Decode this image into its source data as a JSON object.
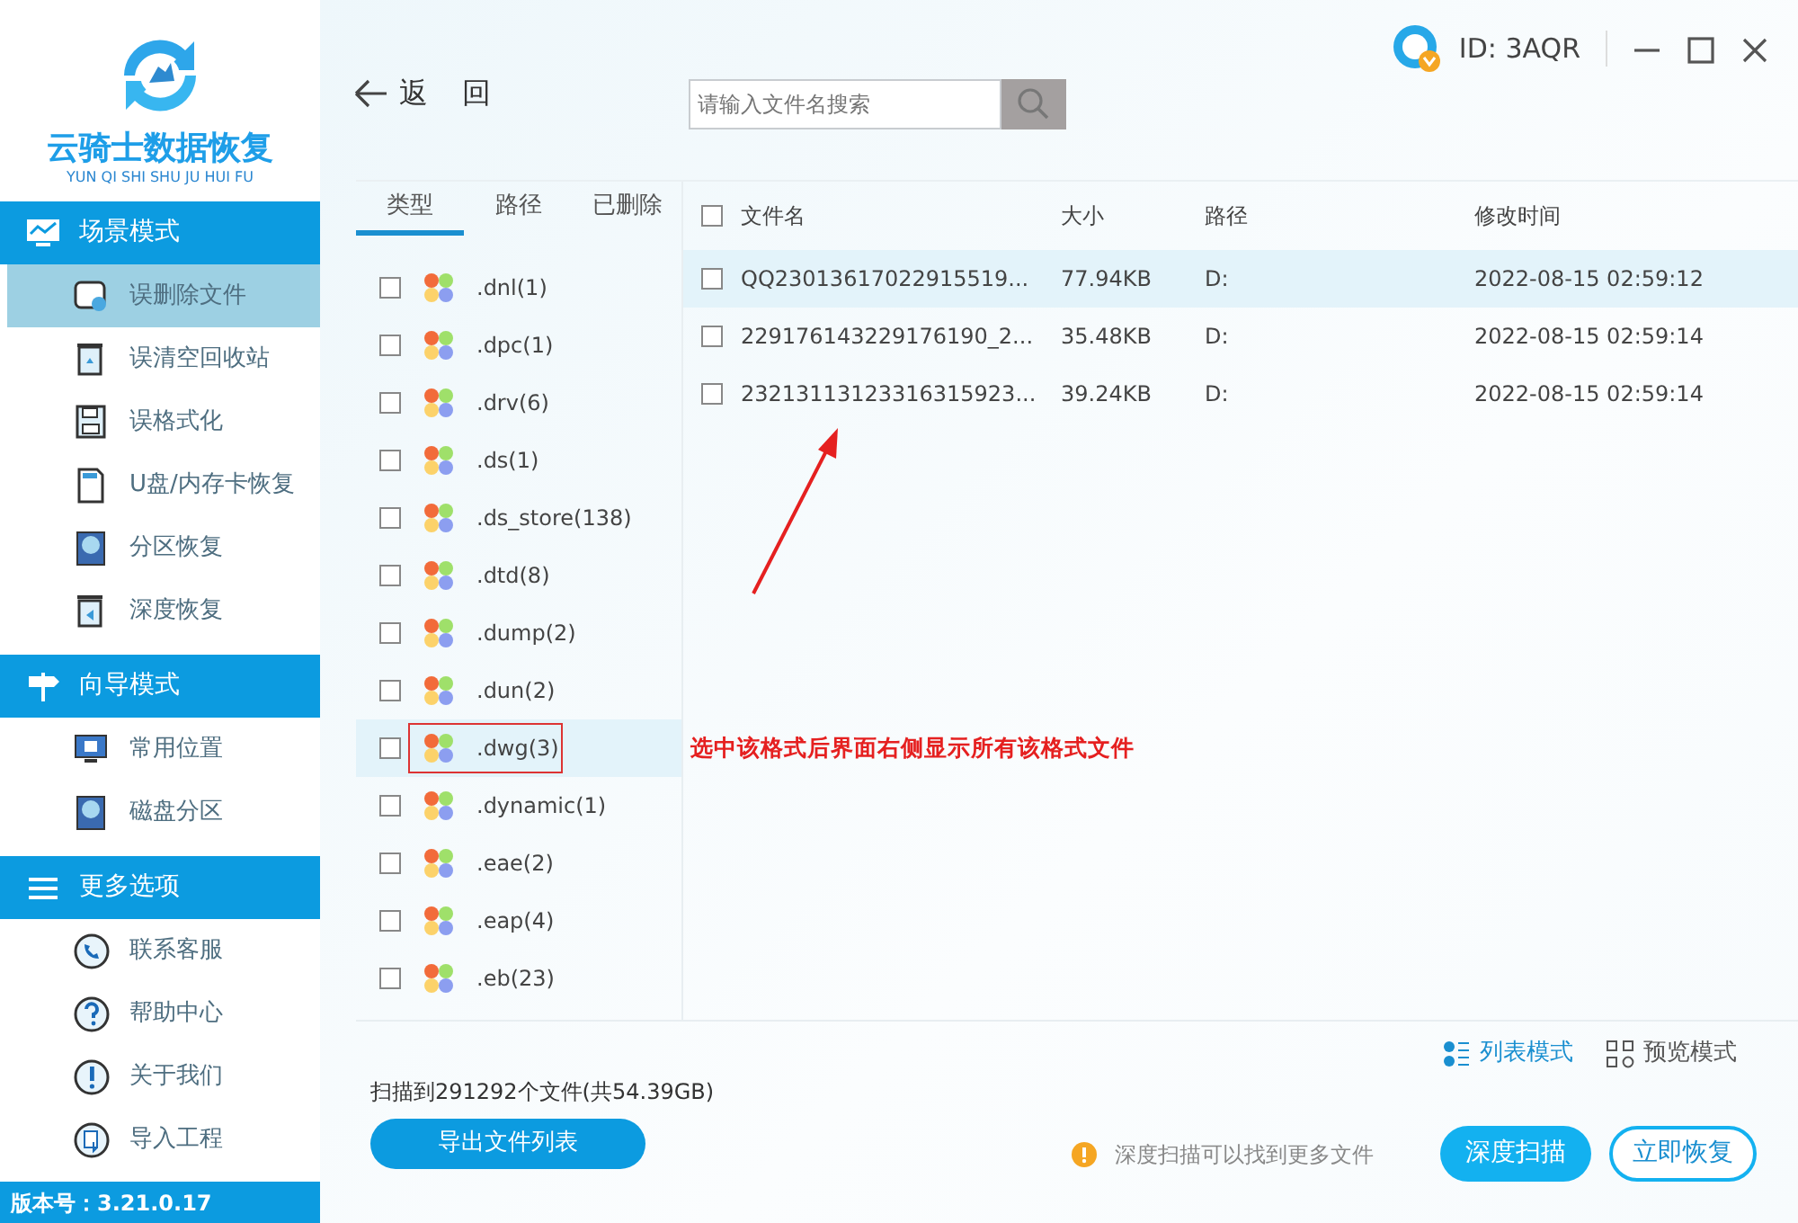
{
  "sidebar": {
    "app_name": "云骑士数据恢复",
    "app_pinyin": "YUN QI SHI SHU JU HUI FU",
    "sections": [
      {
        "title": "场景模式",
        "items": [
          {
            "label": "误删除文件",
            "selected": true
          },
          {
            "label": "误清空回收站",
            "selected": false
          },
          {
            "label": "误格式化",
            "selected": false
          },
          {
            "label": "U盘/内存卡恢复",
            "selected": false
          },
          {
            "label": "分区恢复",
            "selected": false
          },
          {
            "label": "深度恢复",
            "selected": false
          }
        ]
      },
      {
        "title": "向导模式",
        "items": [
          {
            "label": "常用位置",
            "selected": false
          },
          {
            "label": "磁盘分区",
            "selected": false
          }
        ]
      },
      {
        "title": "更多选项",
        "items": [
          {
            "label": "联系客服",
            "selected": false
          },
          {
            "label": "帮助中心",
            "selected": false
          },
          {
            "label": "关于我们",
            "selected": false
          },
          {
            "label": "导入工程",
            "selected": false
          }
        ]
      }
    ],
    "version": "版本号：3.21.0.17"
  },
  "header": {
    "back": "返 回",
    "search": {
      "placeholder": "请输入文件名搜索"
    },
    "user_id": "ID: 3AQR"
  },
  "filter_tabs": [
    {
      "label": "类型",
      "selected": true
    },
    {
      "label": "路径",
      "selected": false
    },
    {
      "label": "已删除",
      "selected": false
    }
  ],
  "types": [
    {
      "label": ".dnl(1)",
      "checked": false,
      "selected": false
    },
    {
      "label": ".dpc(1)",
      "checked": false,
      "selected": false
    },
    {
      "label": ".drv(6)",
      "checked": false,
      "selected": false
    },
    {
      "label": ".ds(1)",
      "checked": false,
      "selected": false
    },
    {
      "label": ".ds_store(138)",
      "checked": false,
      "selected": false
    },
    {
      "label": ".dtd(8)",
      "checked": false,
      "selected": false
    },
    {
      "label": ".dump(2)",
      "checked": false,
      "selected": false
    },
    {
      "label": ".dun(2)",
      "checked": false,
      "selected": false
    },
    {
      "label": ".dwg(3)",
      "checked": false,
      "selected": true
    },
    {
      "label": ".dynamic(1)",
      "checked": false,
      "selected": false
    },
    {
      "label": ".eae(2)",
      "checked": false,
      "selected": false
    },
    {
      "label": ".eap(4)",
      "checked": false,
      "selected": false
    },
    {
      "label": ".eb(23)",
      "checked": false,
      "selected": false
    }
  ],
  "table": {
    "all_checked": false,
    "columns": [
      "文件名",
      "大小",
      "路径",
      "修改时间"
    ],
    "rows": [
      {
        "cells": [
          "QQ23013617022915519...",
          "77.94KB",
          "D:",
          "2022-08-15 02:59:12"
        ],
        "checked": false,
        "selected": true
      },
      {
        "cells": [
          "229176143229176190_2...",
          "35.48KB",
          "D:",
          "2022-08-15 02:59:14"
        ],
        "checked": false,
        "selected": false
      },
      {
        "cells": [
          "23213113123316315923...",
          "39.24KB",
          "D:",
          "2022-08-15 02:59:14"
        ],
        "checked": false,
        "selected": false
      }
    ]
  },
  "view_modes": [
    {
      "label": "列表模式",
      "selected": true
    },
    {
      "label": "预览模式",
      "selected": false
    }
  ],
  "scan_summary": "扫描到291292个文件(共54.39GB)",
  "export_button": "导出文件列表",
  "tip": "深度扫描可以找到更多文件",
  "deep_scan_button": "深度扫描",
  "recover_button": "立即恢复",
  "annotation": {
    "text": "选中该格式后界面右侧显示所有该格式文件"
  }
}
